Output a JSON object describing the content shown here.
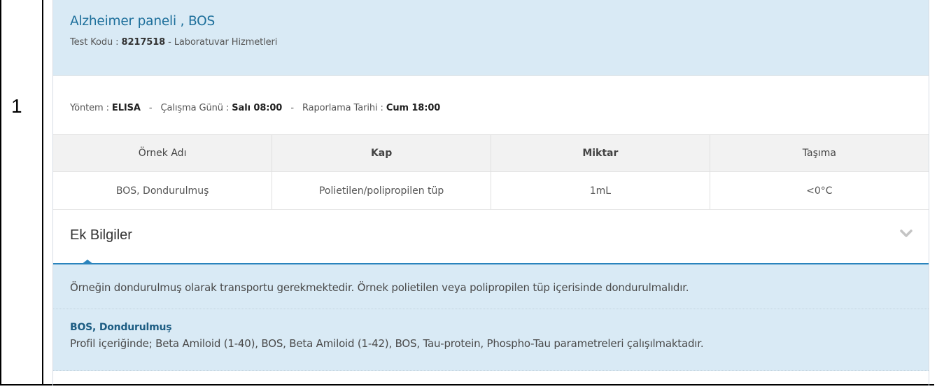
{
  "row_number": "1",
  "card": {
    "title": "Alzheimer paneli , BOS",
    "test_code_label": "Test Kodu : ",
    "test_code": "8217518",
    "department": " - Laboratuvar Hizmetleri"
  },
  "meta": {
    "method_label": "Yöntem : ",
    "method": "ELISA",
    "work_day_label": "Çalışma Günü : ",
    "work_day": "Salı 08:00",
    "report_label": "Raporlama Tarihi : ",
    "report": "Cum 18:00",
    "separator": "-"
  },
  "table": {
    "headers": [
      "Örnek Adı",
      "Kap",
      "Miktar",
      "Taşıma"
    ],
    "rows": [
      [
        "BOS, Dondurulmuş",
        "Polietilen/polipropilen tüp",
        "1mL",
        "<0°C"
      ]
    ]
  },
  "additional": {
    "title": "Ek Bilgiler",
    "chevron_icon": "chevron-down-icon",
    "note": "Örneğin dondurulmuş olarak transportu gerekmektedir. Örnek polietilen veya polipropilen tüp içerisinde dondurulmalıdır.",
    "sample_name": "BOS, Dondurulmuş",
    "sample_desc": "Profil içeriğinde; Beta Amiloid (1-40), BOS, Beta Amiloid (1-42), BOS, Tau-protein, Phospho-Tau parametreleri çalışılmaktadır."
  },
  "colors": {
    "header_bg": "#d9eaf5",
    "title": "#1d6f9b",
    "accent": "#2a84bd"
  }
}
